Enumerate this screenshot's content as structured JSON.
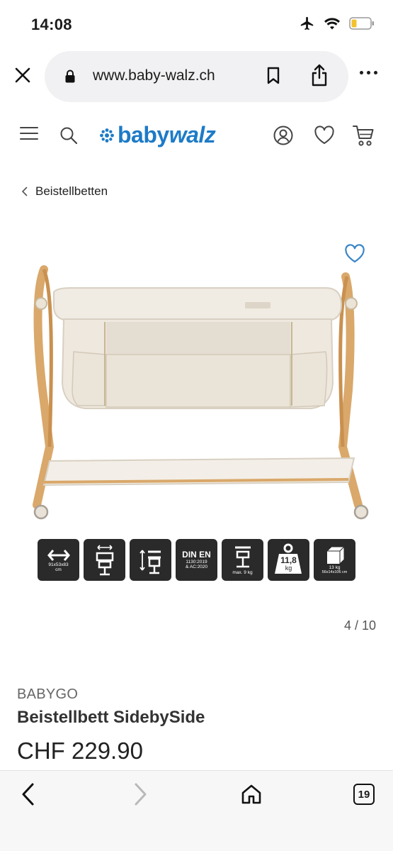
{
  "status_bar": {
    "time": "14:08"
  },
  "browser": {
    "url": "www.baby-walz.ch"
  },
  "breadcrumb": {
    "label": "Beistellbetten"
  },
  "features": {
    "size_line1": "91x53x83",
    "size_line2": "cm",
    "din_title": "DIN EN",
    "din_line1": "1130:2019",
    "din_line2": "& AC:2020",
    "load_label": "max. 9 kg",
    "weight_value": "11,8",
    "weight_unit": "kg",
    "package_weight": "13 kg",
    "package_dims": "56x14x106 cm"
  },
  "gallery": {
    "pager": "4 / 10"
  },
  "product": {
    "brand": "BABYGO",
    "name": "Beistellbett SidebySide",
    "price": "CHF 229.90"
  },
  "toolbar": {
    "tabs_count": "19"
  },
  "colors": {
    "brand_blue": "#1d7bc7",
    "accent_blue": "#3a86c8"
  }
}
